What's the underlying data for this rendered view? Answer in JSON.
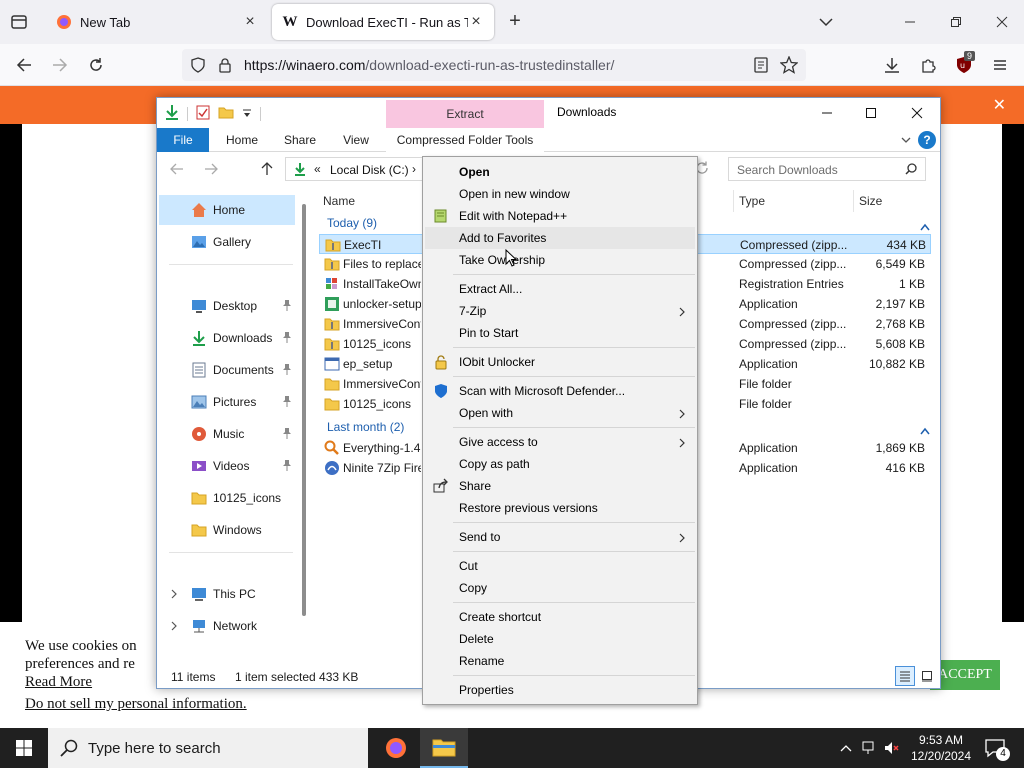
{
  "browser": {
    "tabs": [
      {
        "title": "New Tab"
      },
      {
        "title": "Download ExecTI - Run as Trust"
      }
    ],
    "url": {
      "domain": "https://winaero.com",
      "path": "/download-execti-run-as-trustedinstaller/"
    },
    "ublock_badge": "9"
  },
  "page": {
    "banner_close": "✕",
    "cookie": {
      "line1": "We use cookies on",
      "line2": "preferences and re",
      "read_more": "Read More",
      "do_not_sell": "Do not sell my personal information",
      "accept": "ACCEPT"
    }
  },
  "explorer": {
    "title": "Downloads",
    "context_tab": "Extract",
    "ribbon_tabs": [
      "File",
      "Home",
      "Share",
      "View",
      "Compressed Folder Tools"
    ],
    "address": {
      "prefix": "«",
      "location": "Local Disk (C:)",
      "sep": "›"
    },
    "search_placeholder": "Search Downloads",
    "nav": [
      {
        "label": "Home"
      },
      {
        "label": "Gallery"
      },
      {
        "label": "Desktop"
      },
      {
        "label": "Downloads"
      },
      {
        "label": "Documents"
      },
      {
        "label": "Pictures"
      },
      {
        "label": "Music"
      },
      {
        "label": "Videos"
      },
      {
        "label": "10125_icons"
      },
      {
        "label": "Windows"
      },
      {
        "label": "This PC"
      },
      {
        "label": "Network"
      }
    ],
    "columns": {
      "name": "Name",
      "type": "Type",
      "size": "Size"
    },
    "groups": {
      "today": "Today (9)",
      "last_month": "Last month (2)"
    },
    "files": [
      {
        "name": "ExecTI",
        "type": "Compressed (zipp...",
        "size": "434 KB"
      },
      {
        "name": "Files to replace",
        "type": "Compressed (zipp...",
        "size": "6,549 KB"
      },
      {
        "name": "InstallTakeOwn",
        "type": "Registration Entries",
        "size": "1 KB"
      },
      {
        "name": "unlocker-setup",
        "type": "Application",
        "size": "2,197 KB"
      },
      {
        "name": "ImmersiveConf",
        "type": "Compressed (zipp...",
        "size": "2,768 KB"
      },
      {
        "name": "10125_icons",
        "type": "Compressed (zipp...",
        "size": "5,608 KB"
      },
      {
        "name": "ep_setup",
        "type": "Application",
        "size": "10,882 KB"
      },
      {
        "name": "ImmersiveConf",
        "type": "File folder",
        "size": ""
      },
      {
        "name": "10125_icons",
        "type": "File folder",
        "size": ""
      },
      {
        "name": "Everything-1.4.",
        "type": "Application",
        "size": "1,869 KB"
      },
      {
        "name": "Ninite 7Zip Fire",
        "type": "Application",
        "size": "416 KB"
      }
    ],
    "status": {
      "count": "11 items",
      "selection": "1 item selected  433 KB"
    }
  },
  "context_menu": {
    "items": [
      {
        "label": "Open"
      },
      {
        "label": "Open in new window"
      },
      {
        "label": "Edit with Notepad++"
      },
      {
        "label": "Add to Favorites"
      },
      {
        "label": "Take Ownership"
      },
      {
        "label": "Extract All..."
      },
      {
        "label": "7-Zip"
      },
      {
        "label": "Pin to Start"
      },
      {
        "label": "IObit Unlocker"
      },
      {
        "label": "Scan with Microsoft Defender..."
      },
      {
        "label": "Open with"
      },
      {
        "label": "Give access to"
      },
      {
        "label": "Copy as path"
      },
      {
        "label": "Share"
      },
      {
        "label": "Restore previous versions"
      },
      {
        "label": "Send to"
      },
      {
        "label": "Cut"
      },
      {
        "label": "Copy"
      },
      {
        "label": "Create shortcut"
      },
      {
        "label": "Delete"
      },
      {
        "label": "Rename"
      },
      {
        "label": "Properties"
      }
    ]
  },
  "taskbar": {
    "search_placeholder": "Type here to search",
    "time": "9:53 AM",
    "date": "12/20/2024",
    "notifications": "4"
  },
  "colors": {
    "accent": "#1979ca",
    "banner": "#f46b27",
    "selection": "#cce8ff",
    "accept": "#4caf50"
  }
}
